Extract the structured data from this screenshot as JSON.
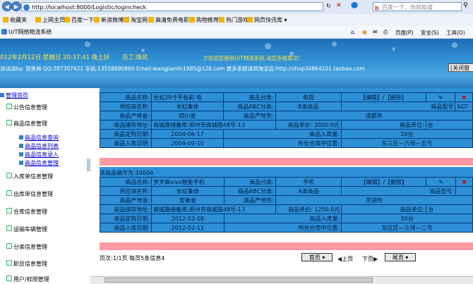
{
  "browser": {
    "url": "http://localhost:8000/Logistic/logincheck",
    "search_placeholder": "百度一下，你就知道",
    "favorites_label": "收藏夹",
    "favorites": [
      "上网主页",
      "百度一下",
      "新浪微博",
      "淘宝网",
      "高清免费电影",
      "购物推荐",
      "热门游戏",
      "网页快讯库"
    ],
    "tab_title": "U/T网络物流系统",
    "tools": [
      "页面(P)",
      "安全(S)",
      "工具(O)"
    ]
  },
  "banner": {
    "date_greeting": "012年2月12日 星期日  20:37:41 晚上好",
    "staff": "员工:陈凯",
    "marquee": "ƒ!欢迎您使用U/T物流系统,请您多提意见!",
    "contact_line": "测试请by: 双鱼林 QQ:287307421 手机:13558690869 Email:wangjianlin1985@126.com 更多系统请到淘宝店:http://shop34864101.taobao.com",
    "close_button": "[关闭窗"
  },
  "sidebar": {
    "home": "管理首页",
    "menus": [
      "公告信息管理",
      "商品信息管理",
      "入库单信息管理",
      "出库单信息管理",
      "仓库信息管理",
      "运输车辆管理",
      "分类信息管理",
      "职员信息管理",
      "用户/权限管理"
    ],
    "submenus": [
      "商品信息查询",
      "商品信息列表",
      "商品信息录入",
      "商品信息管理"
    ]
  },
  "records": [
    {
      "title": "",
      "product_name_label": "商品名称:",
      "product_name": "长虹29寸平板彩 电",
      "category_label": "商品分类:",
      "category": "电视",
      "actions": "【编辑】/【删除】",
      "supplier_label": "供应商名称:",
      "supplier": "长虹集体",
      "abc_label": "商品ABC分类:",
      "abc": "B类商品",
      "model_label": "商品型号",
      "model": "SGT",
      "origin_label": "商品产地省:",
      "origin": "四川省",
      "city_label": "商品产地市:",
      "city": "成都市",
      "storage_label": "商品储存地址:",
      "storage": "商城路储备库:郑州市商城路48号-13",
      "price_label": "商品单价:",
      "price": "3000.0元",
      "unit_label": "商品单位:",
      "unit": "台",
      "order_date_label": "商品定购日期:",
      "order_date": "2004-06-17",
      "stock_label": "商品入库量:",
      "stock": "20台",
      "in_date_label": "商品入库日期:",
      "in_date": "2004-09-10",
      "warehouse_label": "所处仓库中位置:",
      "warehouse": "东三区—六排—五号"
    },
    {
      "title": "该商品编号为:10004",
      "product_name_label": "商品名称:",
      "product_name": "步步高vivo智能手机",
      "category_label": "商品分类:",
      "category": "手机",
      "actions": "【编辑】/【删除】",
      "supplier_label": "供应商名称:",
      "supplier": "长虹集体",
      "abc_label": "商品ABC分类:",
      "abc": "A类商品",
      "model_label": "商品型号:",
      "model": "",
      "origin_label": "商品产地省:",
      "origin": "安徽省",
      "city_label": "商品产地市:",
      "city": "芜湖市",
      "storage_label": "商品储存地址:",
      "storage": "商城路储备库:郑州市商城路48号-13",
      "price_label": "商品单价:",
      "price": "1250.0元",
      "unit_label": "商品单位:",
      "unit": "台",
      "order_date_label": "商品定购日期:",
      "order_date": "2012-02-08",
      "stock_label": "商品入库量:",
      "stock": "50台",
      "in_date_label": "商品入库日期:",
      "in_date": "2012-02-11",
      "warehouse_label": "所处仓库中位置:",
      "warehouse": "东区区—三排—二号"
    }
  ],
  "pager": {
    "info": "页次:1/1页 每页5条信息4",
    "first": "首页",
    "prev": "上页",
    "next": "下页",
    "last": "尾页"
  }
}
